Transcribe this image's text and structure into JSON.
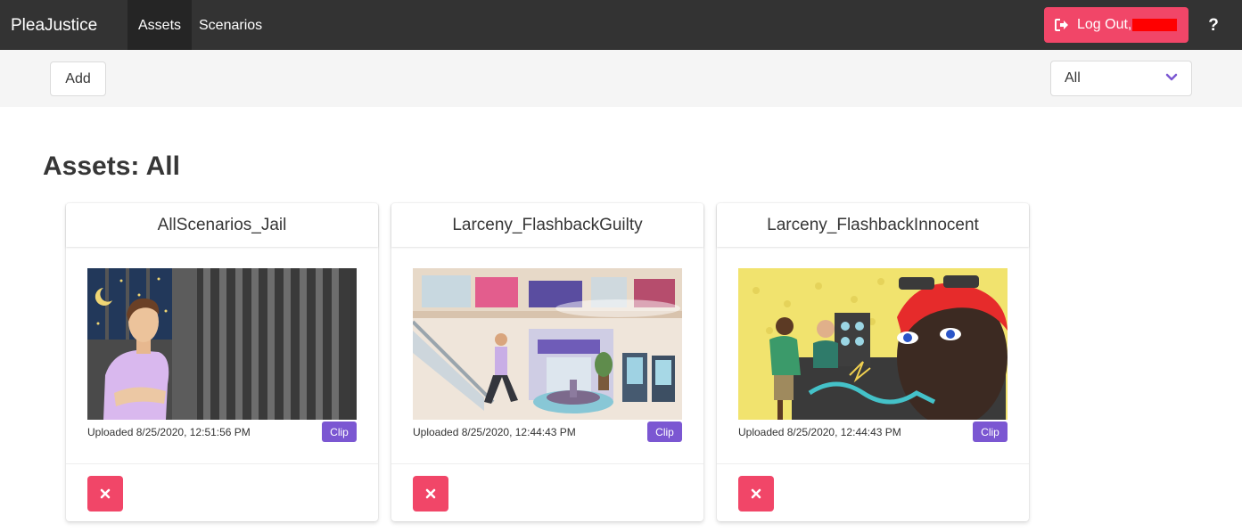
{
  "navbar": {
    "brand": "PleaJustice",
    "links": [
      {
        "label": "Assets",
        "active": true
      },
      {
        "label": "Scenarios",
        "active": false
      }
    ],
    "logout_label": "Log Out,",
    "logout_icon": "sign-out-icon",
    "help_label": "?"
  },
  "toolbar": {
    "add_label": "Add",
    "filter_selected": "All"
  },
  "page": {
    "title": "Assets: All"
  },
  "assets": [
    {
      "name": "AllScenarios_Jail",
      "uploaded": "Uploaded 8/25/2020, 12:51:56 PM",
      "tag": "Clip"
    },
    {
      "name": "Larceny_FlashbackGuilty",
      "uploaded": "Uploaded 8/25/2020, 12:44:43 PM",
      "tag": "Clip"
    },
    {
      "name": "Larceny_FlashbackInnocent",
      "uploaded": "Uploaded 8/25/2020, 12:44:43 PM",
      "tag": "Clip"
    }
  ],
  "colors": {
    "navbar_bg": "#333333",
    "danger": "#f14668",
    "tag_purple": "#7b57d2",
    "toolbar_bg": "#f5f5f5"
  }
}
